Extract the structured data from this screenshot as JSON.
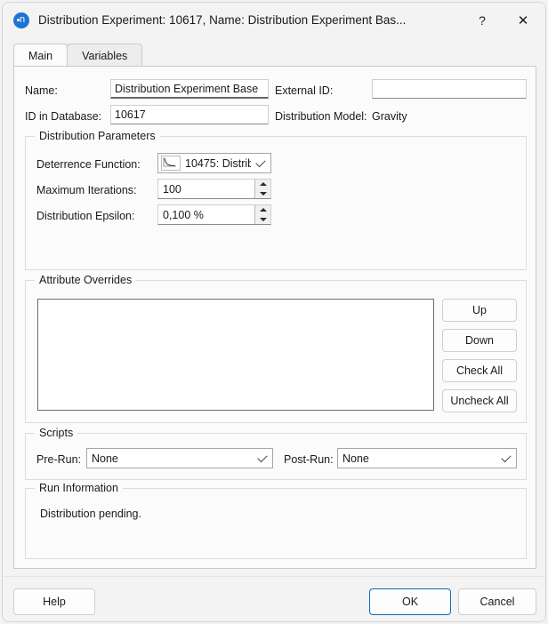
{
  "window": {
    "title": "Distribution Experiment: 10617, Name: Distribution Experiment Bas...",
    "app_icon": "visum-app-icon",
    "help_button": "?",
    "close_button": "✕",
    "accent_color": "#0f6cbd",
    "icon_color": "#1b74d4"
  },
  "tabs": [
    {
      "label": "Main",
      "active": true
    },
    {
      "label": "Variables",
      "active": false
    }
  ],
  "main": {
    "name_label": "Name:",
    "name_value": "Distribution Experiment Base",
    "external_id_label": "External ID:",
    "external_id_value": "",
    "id_in_database_label": "ID in Database:",
    "id_in_database_value": "10617",
    "distribution_model_label": "Distribution Model:",
    "distribution_model_value": "Gravity",
    "distribution_parameters": {
      "title": "Distribution Parameters",
      "deterrence_function_label": "Deterrence Function:",
      "deterrence_function_value": "10475: Distrib",
      "deterrence_function_icon": "curve-chart-icon",
      "maximum_iterations_label": "Maximum Iterations:",
      "maximum_iterations_value": "100",
      "distribution_epsilon_label": "Distribution Epsilon:",
      "distribution_epsilon_value": "0,100 %"
    },
    "attribute_overrides": {
      "title": "Attribute Overrides",
      "items": [],
      "buttons": [
        {
          "label": "Up",
          "name": "up-button"
        },
        {
          "label": "Down",
          "name": "down-button"
        },
        {
          "label": "Check All",
          "name": "check-all-button"
        },
        {
          "label": "Uncheck All",
          "name": "uncheck-all-button"
        }
      ]
    },
    "scripts": {
      "title": "Scripts",
      "pre_run_label": "Pre-Run:",
      "pre_run_value": "None",
      "post_run_label": "Post-Run:",
      "post_run_value": "None"
    },
    "run_information": {
      "title": "Run Information",
      "status_text": "Distribution pending."
    }
  },
  "footer": {
    "help_label": "Help",
    "ok_label": "OK",
    "cancel_label": "Cancel"
  }
}
